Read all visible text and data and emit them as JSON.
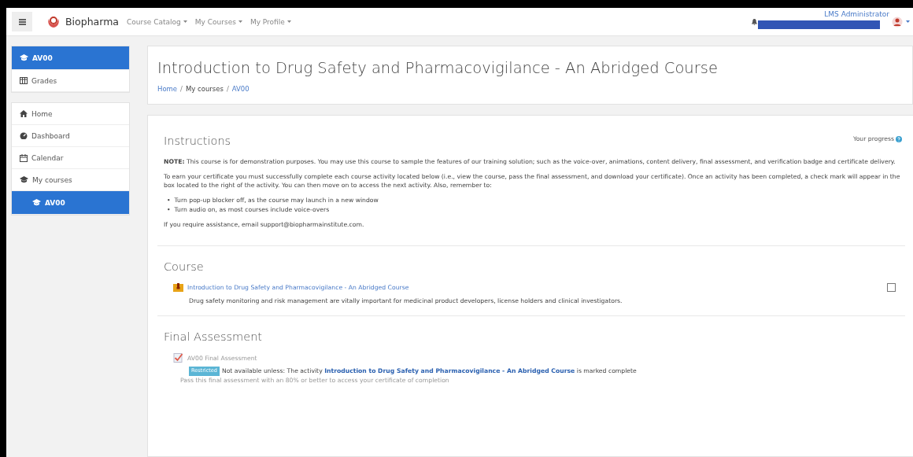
{
  "navbar": {
    "brand": "Biopharma",
    "menus": [
      {
        "label": "Course Catalog"
      },
      {
        "label": "My Courses"
      },
      {
        "label": "My Profile"
      }
    ],
    "user": "LMS Administrator"
  },
  "sidebar": {
    "groups": [
      {
        "items": [
          {
            "label": "AV00",
            "kind": "course",
            "selected": true
          },
          {
            "label": "Grades",
            "kind": "grades",
            "selected": false
          }
        ]
      },
      {
        "items": [
          {
            "label": "Home",
            "kind": "home",
            "selected": false
          },
          {
            "label": "Dashboard",
            "kind": "dashboard",
            "selected": false
          },
          {
            "label": "Calendar",
            "kind": "calendar",
            "selected": false
          },
          {
            "label": "My courses",
            "kind": "course",
            "selected": false,
            "children": [
              {
                "label": "AV00",
                "kind": "course",
                "selected": true
              }
            ]
          }
        ]
      }
    ]
  },
  "header": {
    "title": "Introduction to Drug Safety and Pharmacovigilance - An Abridged Course",
    "separator": "/",
    "breadcrumb": [
      {
        "label": "Home",
        "link": true
      },
      {
        "label": "My courses",
        "link": false
      },
      {
        "label": "AV00",
        "link": true
      }
    ]
  },
  "sections": [
    {
      "title": "Instructions",
      "progress": "Your progress",
      "blocks": [
        {
          "kind": "paragraph",
          "text": "**NOTE:** This course is for demonstration purposes. You may use this course to sample the features of our training solution; such as the voice-over, animations, content delivery, final assessment, and verification badge and certificate delivery."
        },
        {
          "kind": "paragraph",
          "text": "To earn your certificate you must successfully complete each course activity located below (i.e., view the course, pass the final assessment, and download your certificate). Once an activity has been completed, a check mark will appear in the box located to the right of the activity. You can then move on to access the next activity. Also, remember to:"
        },
        {
          "kind": "bullets",
          "marker": "•",
          "items": [
            "Turn pop-up blocker off, as the course may launch in a new window",
            "Turn audio on, as most courses include voice-overs"
          ]
        },
        {
          "kind": "paragraph",
          "text": "If you require assistance, email support@biopharmainstitute.com."
        }
      ]
    },
    {
      "title": "Course",
      "activities": [
        {
          "kind": "package",
          "title": "Introduction to Drug Safety and Pharmacovigilance - An Abridged Course",
          "available": true,
          "completed": false,
          "description": "Drug safety monitoring and risk management are vitally important for medicinal product developers, license holders and clinical investigators."
        }
      ]
    },
    {
      "title": "Final Assessment",
      "activities": [
        {
          "kind": "quiz",
          "title": "AV00 Final Assessment",
          "available": false,
          "badge": "Restricted",
          "restriction": "Not available unless: The activity **Introduction to Drug Safety and Pharmacovigilance - An Abridged Course** is marked complete",
          "note": "Pass this final assessment with an 80% or better to access your certificate of completion"
        }
      ]
    }
  ]
}
